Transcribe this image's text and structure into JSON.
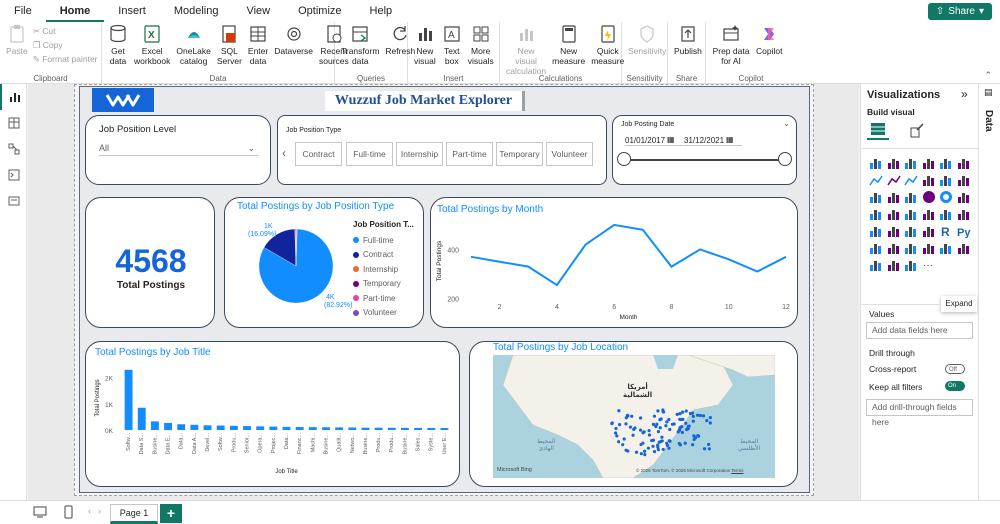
{
  "menu": {
    "items": [
      "File",
      "Home",
      "Insert",
      "Modeling",
      "View",
      "Optimize",
      "Help"
    ],
    "active": "Home",
    "share_label": "Share"
  },
  "ribbon": {
    "clipboard": {
      "paste": "Paste",
      "cut": "Cut",
      "copy": "Copy",
      "format_painter": "Format painter",
      "label": "Clipboard"
    },
    "data": {
      "label": "Data",
      "buttons": [
        "Get data",
        "Excel workbook",
        "OneLake catalog",
        "SQL Server",
        "Enter data",
        "Dataverse",
        "Recent sources"
      ]
    },
    "queries": {
      "label": "Queries",
      "buttons": [
        "Transform data",
        "Refresh"
      ]
    },
    "insert": {
      "label": "Insert",
      "buttons": [
        "New visual",
        "Text box",
        "More visuals"
      ]
    },
    "calculations": {
      "label": "Calculations",
      "buttons": [
        "New visual calculation",
        "New measure",
        "Quick measure"
      ]
    },
    "sensitivity": {
      "label": "Sensitivity",
      "buttons": [
        "Sensitivity"
      ]
    },
    "share": {
      "label": "Share",
      "buttons": [
        "Publish"
      ]
    },
    "copilot": {
      "label": "Copilot",
      "buttons": [
        "Prep data for AI",
        "Copilot"
      ]
    }
  },
  "report": {
    "title": "Wuzzuf Job Market Explorer",
    "slicers": {
      "position_level": {
        "title": "Job Position Level",
        "value": "All"
      },
      "position_type": {
        "title": "Job Position Type",
        "options": [
          "Contract",
          "Full-time",
          "Internship",
          "Part-time",
          "Temporary",
          "Volunteer"
        ]
      },
      "posting_date": {
        "title": "Job Posting Date",
        "start": "01/01/2017",
        "end": "31/12/2021"
      }
    },
    "kpi": {
      "value": "4568",
      "label": "Total Postings"
    },
    "pie": {
      "title": "Total Postings by Job Position Type",
      "legend_title": "Job Position T...",
      "label_small": "1K",
      "label_small_pct": "(16.09%)",
      "label_large": "4K",
      "label_large_pct": "(82.92%)"
    },
    "line": {
      "title": "Total Postings by Month"
    },
    "bars": {
      "title": "Total Postings by Job Title"
    },
    "map": {
      "title": "Total Postings by Job Location",
      "label_na": "أمريكا",
      "label_na2": "الشمالية",
      "label_pacific": "المحيط",
      "label_pacific2": "الهادئ",
      "label_atlantic": "المحيط",
      "label_atlantic2": "الأطلسي",
      "brand": "Microsoft Bing",
      "copyright": "© 2026 TomTom, © 2026 Microsoft Corporation",
      "terms": "Terms"
    }
  },
  "vispane": {
    "title": "Visualizations",
    "build_visual": "Build visual",
    "expand_tooltip": "Expand",
    "values_label": "Values",
    "values_placeholder": "Add data fields here",
    "drill_label": "Drill through",
    "cross_report": "Cross-report",
    "cross_report_state": "Off",
    "keep_filters": "Keep all filters",
    "keep_filters_state": "On",
    "drill_placeholder": "Add drill-through fields here"
  },
  "datapane": {
    "label": "Data"
  },
  "pages": {
    "tab": "Page 1"
  },
  "chart_data": [
    {
      "type": "pie",
      "title": "Total Postings by Job Position Type",
      "legend": [
        "Full-time",
        "Contract",
        "Internship",
        "Temporary",
        "Part-time",
        "Volunteer"
      ],
      "colors": [
        "#118dff",
        "#12239e",
        "#e66c37",
        "#6b007b",
        "#e044a7",
        "#744ec2"
      ],
      "values": [
        82.92,
        16.09,
        0.3,
        0.25,
        0.24,
        0.2
      ]
    },
    {
      "type": "line",
      "title": "Total Postings by Month",
      "xlabel": "Month",
      "ylabel": "Total Postings",
      "x": [
        1,
        2,
        3,
        4,
        5,
        6,
        7,
        8,
        9,
        10,
        11,
        12
      ],
      "values": [
        370,
        350,
        330,
        255,
        420,
        500,
        480,
        330,
        400,
        360,
        310,
        370
      ],
      "xticks": [
        2,
        4,
        6,
        8,
        10,
        12
      ],
      "yticks": [
        200,
        400
      ],
      "ylim": [
        190,
        520
      ]
    },
    {
      "type": "bar",
      "title": "Total Postings by Job Title",
      "xlabel": "Job Title",
      "ylabel": "Total Postings",
      "categories": [
        "Softw...",
        "Data S...",
        "Busine...",
        "Data E...",
        "Data...",
        "Data A...",
        "Devel...",
        "Softw...",
        "Produ...",
        "Senior...",
        "Opera...",
        "Projec...",
        "Data...",
        "Financ...",
        "Machi...",
        "Busine...",
        "Qualit...",
        "Netwo...",
        "Busine...",
        "Produ...",
        "Produ...",
        "Busine...",
        "Sales...",
        "Syste...",
        "User E..."
      ],
      "values": [
        2300,
        850,
        330,
        270,
        220,
        200,
        180,
        170,
        160,
        150,
        140,
        130,
        120,
        115,
        110,
        105,
        100,
        95,
        90,
        88,
        85,
        82,
        80,
        78,
        75
      ],
      "yticks": [
        "0K",
        "1K",
        "2K"
      ],
      "ylim": [
        0,
        2600
      ]
    }
  ]
}
